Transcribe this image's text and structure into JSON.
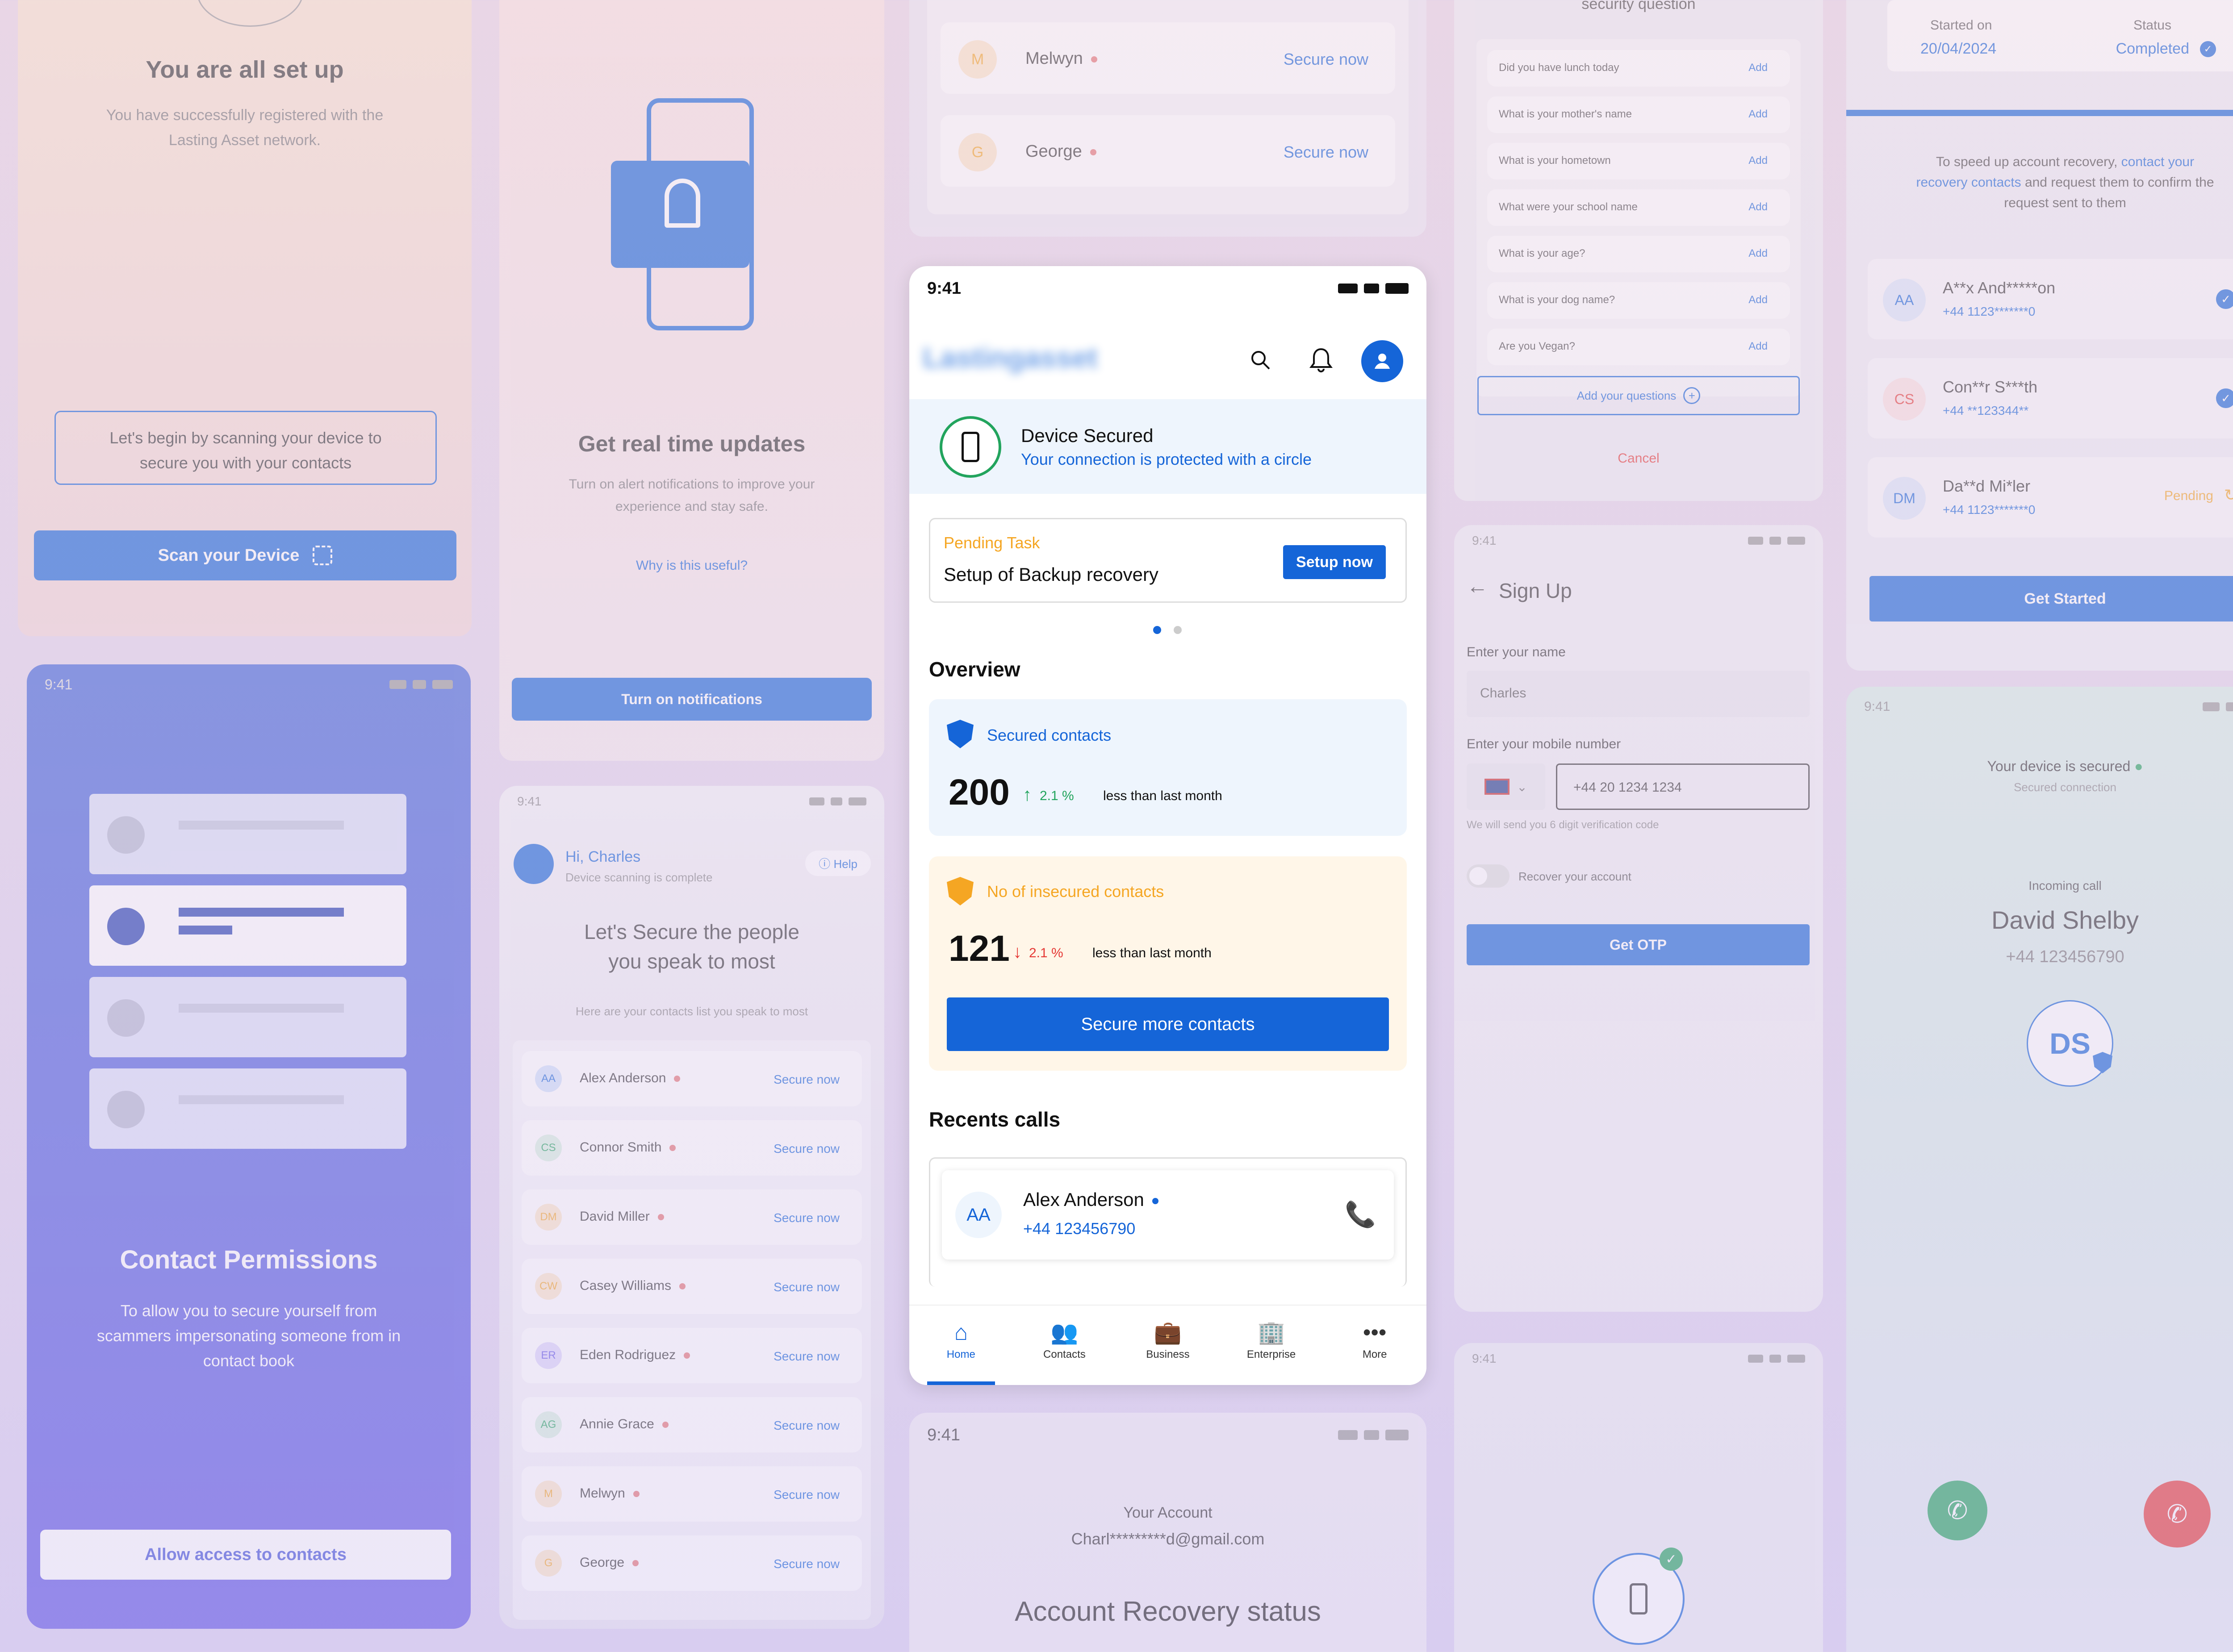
{
  "statusbar": {
    "time": "9:41"
  },
  "setup": {
    "title": "You are all set up",
    "subtitle": "You have successfully registered with the Lasting Asset network.",
    "scan_hint": "Let's begin by scanning your device to secure you with your contacts",
    "scan_button": "Scan your Device"
  },
  "permissions": {
    "title": "Contact Permissions",
    "body": "To allow you to secure yourself from scammers impersonating someone from in contact book",
    "button": "Allow access to contacts"
  },
  "updates": {
    "title": "Get real time updates",
    "body": "Turn on alert notifications to improve your experience and stay safe.",
    "link": "Why is this useful?",
    "button": "Turn on notifications"
  },
  "secure_list": {
    "greeting": "Hi, Charles",
    "sub": "Device scanning is complete",
    "help": "Help",
    "title_line1": "Let's Secure the people",
    "title_line2": "you speak to most",
    "hint": "Here are your contacts list you speak to most",
    "action": "Secure now",
    "contacts": [
      {
        "initials": "AA",
        "name": "Alex Anderson"
      },
      {
        "initials": "CS",
        "name": "Connor Smith"
      },
      {
        "initials": "DM",
        "name": "David Miller"
      },
      {
        "initials": "CW",
        "name": "Casey Williams"
      },
      {
        "initials": "ER",
        "name": "Eden Rodriguez"
      },
      {
        "initials": "AG",
        "name": "Annie Grace"
      },
      {
        "initials": "M",
        "name": "Melwyn"
      },
      {
        "initials": "G",
        "name": "George"
      }
    ]
  },
  "top_list": {
    "contacts": [
      {
        "initials": "M",
        "name": "Melwyn"
      },
      {
        "initials": "G",
        "name": "George"
      }
    ],
    "action": "Secure now"
  },
  "home": {
    "brand": "Lastingasset",
    "device_title": "Device Secured",
    "device_sub": "Your connection is protected with a circle",
    "pending_label": "Pending Task",
    "pending_title": "Setup of Backup recovery",
    "pending_button": "Setup now",
    "overview": "Overview",
    "secured_label": "Secured contacts",
    "secured_value": "200",
    "secured_pct": "2.1 %",
    "secured_note": "less than last month",
    "insecure_label": "No of insecured contacts",
    "insecure_value": "121",
    "insecure_pct": "2.1 %",
    "insecure_note": "less than last month",
    "secure_more": "Secure more contacts",
    "recents": "Recents calls",
    "call": {
      "initials": "AA",
      "name": "Alex Anderson",
      "number": "+44 123456790"
    },
    "nav": [
      {
        "label": "Home",
        "icon": "home-icon"
      },
      {
        "label": "Contacts",
        "icon": "contacts-icon"
      },
      {
        "label": "Business",
        "icon": "briefcase-icon"
      },
      {
        "label": "Enterprise",
        "icon": "building-icon"
      },
      {
        "label": "More",
        "icon": "more-icon"
      }
    ]
  },
  "account": {
    "label": "Your Account",
    "email": "Charl*********d@gmail.com",
    "title": "Account Recovery status"
  },
  "questions": {
    "title": "security question",
    "add": "Add",
    "items": [
      "Did you have lunch today",
      "What is your mother's name",
      "What is your hometown",
      "What were your school name",
      "What is your age?",
      "What is your dog name?",
      "Are you Vegan?"
    ],
    "add_more": "Add your questions",
    "cancel": "Cancel"
  },
  "signup": {
    "title": "Sign Up",
    "name_label": "Enter your name",
    "name_value": "Charles",
    "phone_label": "Enter your mobile number",
    "phone_value": "+44  20 1234 1234",
    "otp_hint": "We will send you 6 digit verification code",
    "recover": "Recover your account",
    "button": "Get OTP"
  },
  "recovery": {
    "started_label": "Started on",
    "started_value": "20/04/2024",
    "status_label": "Status",
    "status_value": "Completed",
    "intro_a": "To speed up account recovery,",
    "intro_link": "contact your recovery contacts",
    "intro_b": "and request them to confirm the request sent to them",
    "contacts": [
      {
        "initials": "AA",
        "name": "A**x And*****on",
        "number": "+44 1123*******0",
        "state": "done"
      },
      {
        "initials": "CS",
        "name": "Con**r S***th",
        "number": "+44 **123344**",
        "state": "done"
      },
      {
        "initials": "DM",
        "name": "Da**d Mi*ler",
        "number": "+44 1123*******0",
        "state": "Pending"
      }
    ],
    "button": "Get Started"
  },
  "call": {
    "secured": "Your device is secured",
    "secured_sub": "Secured connection",
    "incoming": "Incoming call",
    "name": "David Shelby",
    "number": "+44 123456790",
    "initials": "DS"
  },
  "colors": {
    "primary": "#1565d8",
    "green": "#22a45d",
    "red": "#e53935",
    "orange": "#f5a623"
  }
}
